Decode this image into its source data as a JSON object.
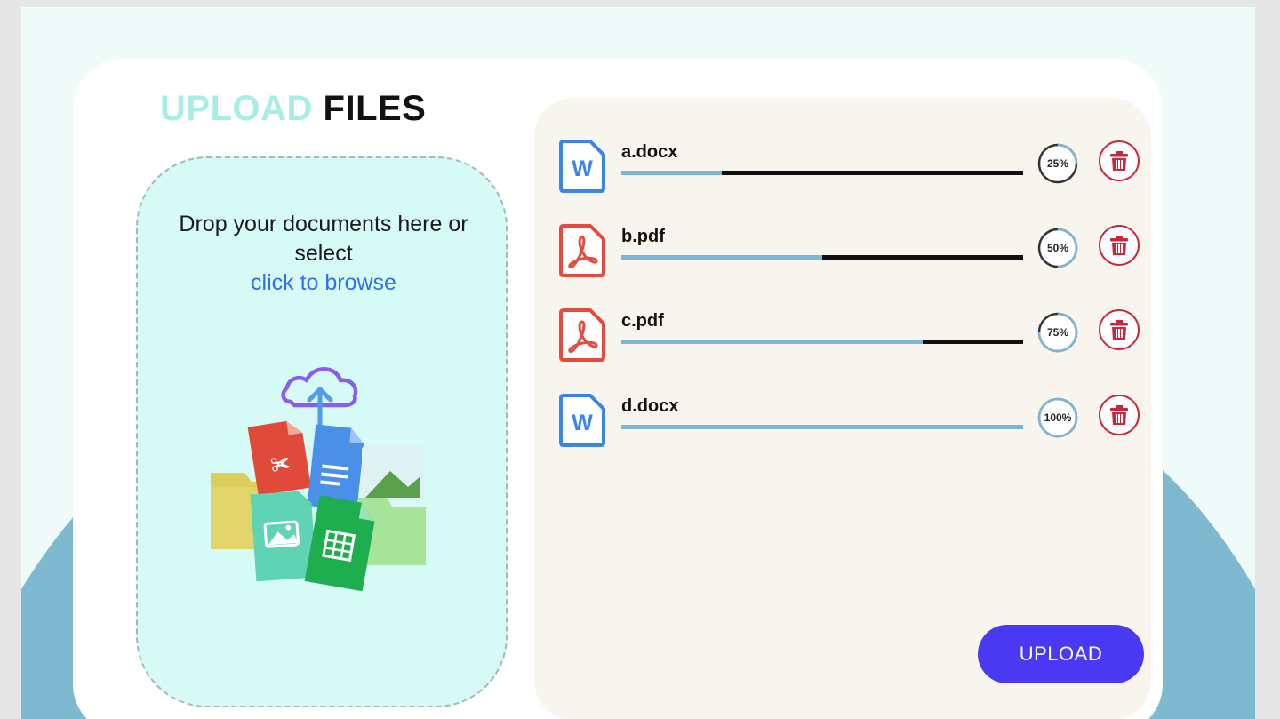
{
  "title": {
    "part1": "UPLOAD",
    "part2": "FILES"
  },
  "dropzone": {
    "line1": "Drop your documents here or",
    "line2": "select",
    "browse_label": "click to browse",
    "art_icon": "documents-cloud-upload-illustration"
  },
  "files": [
    {
      "name": "a.docx",
      "type": "word",
      "icon": "word-file-icon",
      "progress": 25,
      "progress_label": "25%"
    },
    {
      "name": "b.pdf",
      "type": "pdf",
      "icon": "pdf-file-icon",
      "progress": 50,
      "progress_label": "50%"
    },
    {
      "name": "c.pdf",
      "type": "pdf",
      "icon": "pdf-file-icon",
      "progress": 75,
      "progress_label": "75%"
    },
    {
      "name": "d.docx",
      "type": "word",
      "icon": "word-file-icon",
      "progress": 100,
      "progress_label": "100%"
    }
  ],
  "delete_icon": "trash-icon",
  "upload_button": {
    "label": "UPLOAD"
  },
  "colors": {
    "accent": "#4a39f2",
    "title_light": "#a8ece6",
    "word_blue": "#3a86e6",
    "pdf_red": "#e64a3c",
    "delete_red": "#c9273a",
    "progress_fill": "#7cb6d6",
    "dropzone_bg": "#d6faf5",
    "panel_bg": "#f8f5ef"
  }
}
